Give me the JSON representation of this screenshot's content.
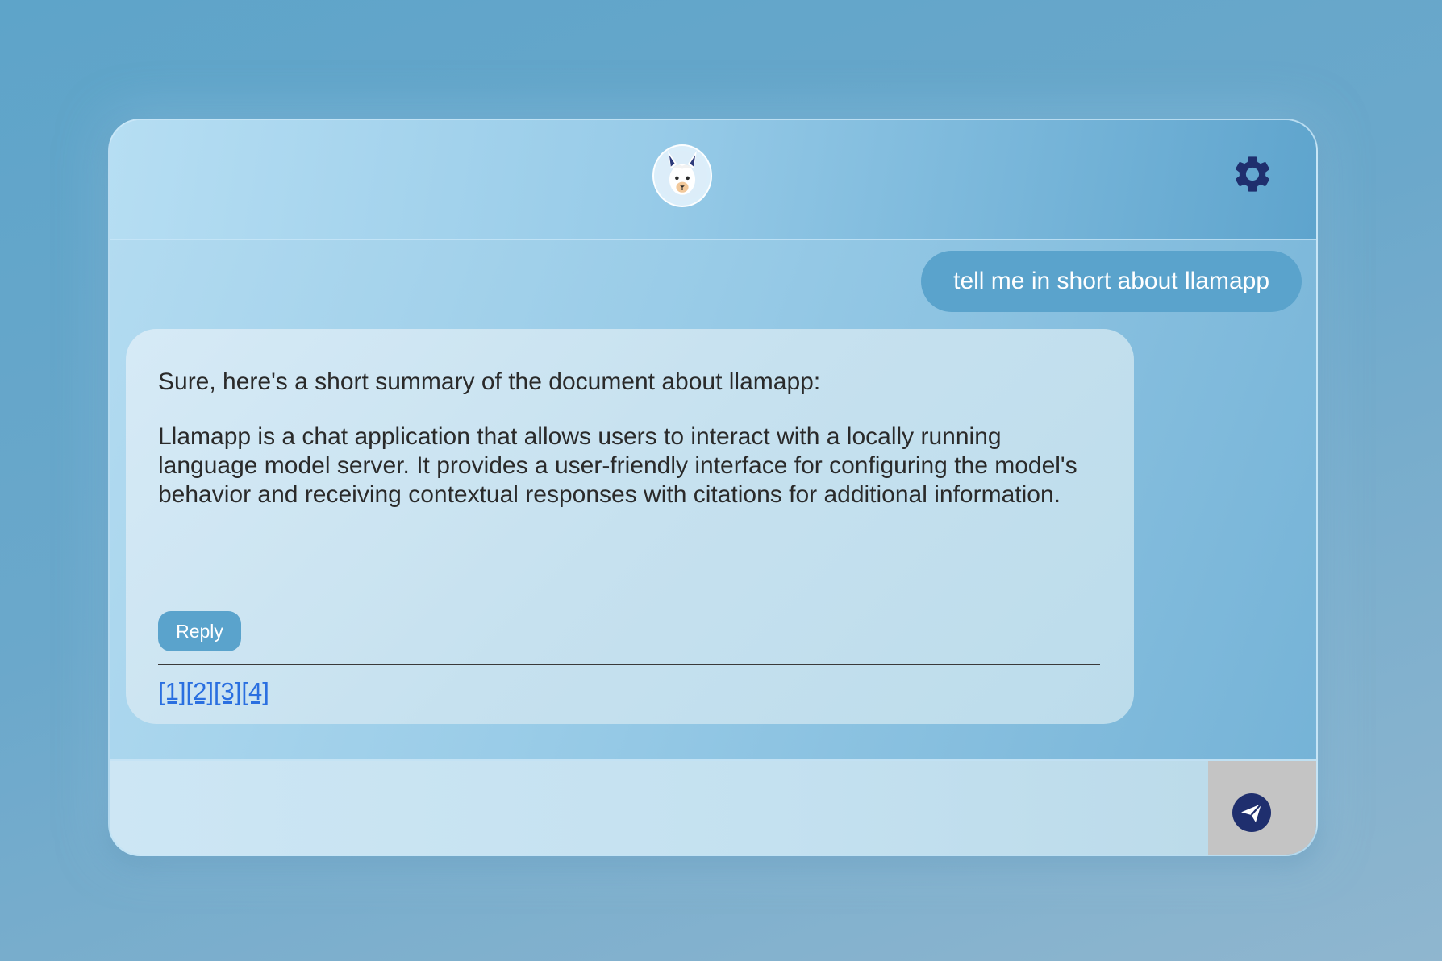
{
  "header": {
    "logo_icon": "llama-icon",
    "settings_icon": "gear-icon"
  },
  "conversation": {
    "user_message": "tell me in short about llamapp",
    "bot_message": {
      "intro": "Sure, here's a short summary of the document about llamapp:",
      "body": "Llamapp is a chat application that allows users to interact with a locally running language model server. It provides a user-friendly interface for configuring the model's behavior and receiving contextual responses with citations for additional information.",
      "reply_label": "Reply",
      "citations": [
        "[1]",
        "[2]",
        "[3]",
        "[4]"
      ]
    }
  },
  "composer": {
    "input_value": "",
    "send_icon": "send-icon"
  },
  "colors": {
    "accent": "#5aa3cc",
    "icon_dark": "#1f2f6e",
    "link": "#2a6fe0",
    "send_bg": "#c4c4c4"
  }
}
